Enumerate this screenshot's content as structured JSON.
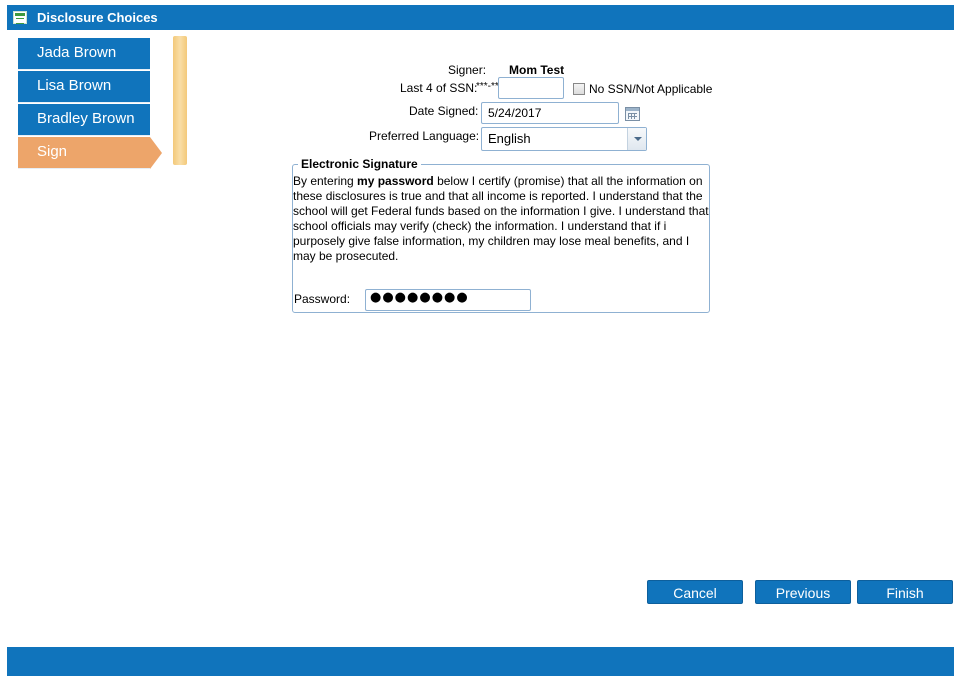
{
  "window": {
    "title": "Disclosure Choices",
    "accent_color": "#1074bc",
    "active_color": "#eda56a"
  },
  "nav": {
    "items": [
      {
        "label": "Jada Brown",
        "active": false
      },
      {
        "label": "Lisa Brown",
        "active": false
      },
      {
        "label": "Bradley Brown",
        "active": false
      },
      {
        "label": "Sign",
        "active": true
      }
    ]
  },
  "form": {
    "signer_label": "Signer:",
    "signer_value": "Mom Test",
    "ssn_label": "Last 4 of SSN:",
    "ssn_mask": "***-**-",
    "ssn_value": "",
    "no_ssn_label": "No SSN/Not Applicable",
    "no_ssn_checked": false,
    "date_label": "Date Signed:",
    "date_value": "5/24/2017",
    "language_label": "Preferred Language:",
    "language_value": "English"
  },
  "signature": {
    "legend": "Electronic Signature",
    "text_before": "By entering ",
    "text_bold": "my password",
    "text_after": " below I certify (promise) that all the information on these disclosures is true and that all income is reported. I understand that the school will get Federal funds based on the information I give. I understand that school officials may verify (check) the information. I understand that if i purposely give false information, my children may lose meal benefits, and I may be prosecuted.",
    "password_label": "Password:",
    "password_masked": "●●●●●●●●"
  },
  "buttons": {
    "cancel": "Cancel",
    "previous": "Previous",
    "finish": "Finish"
  }
}
